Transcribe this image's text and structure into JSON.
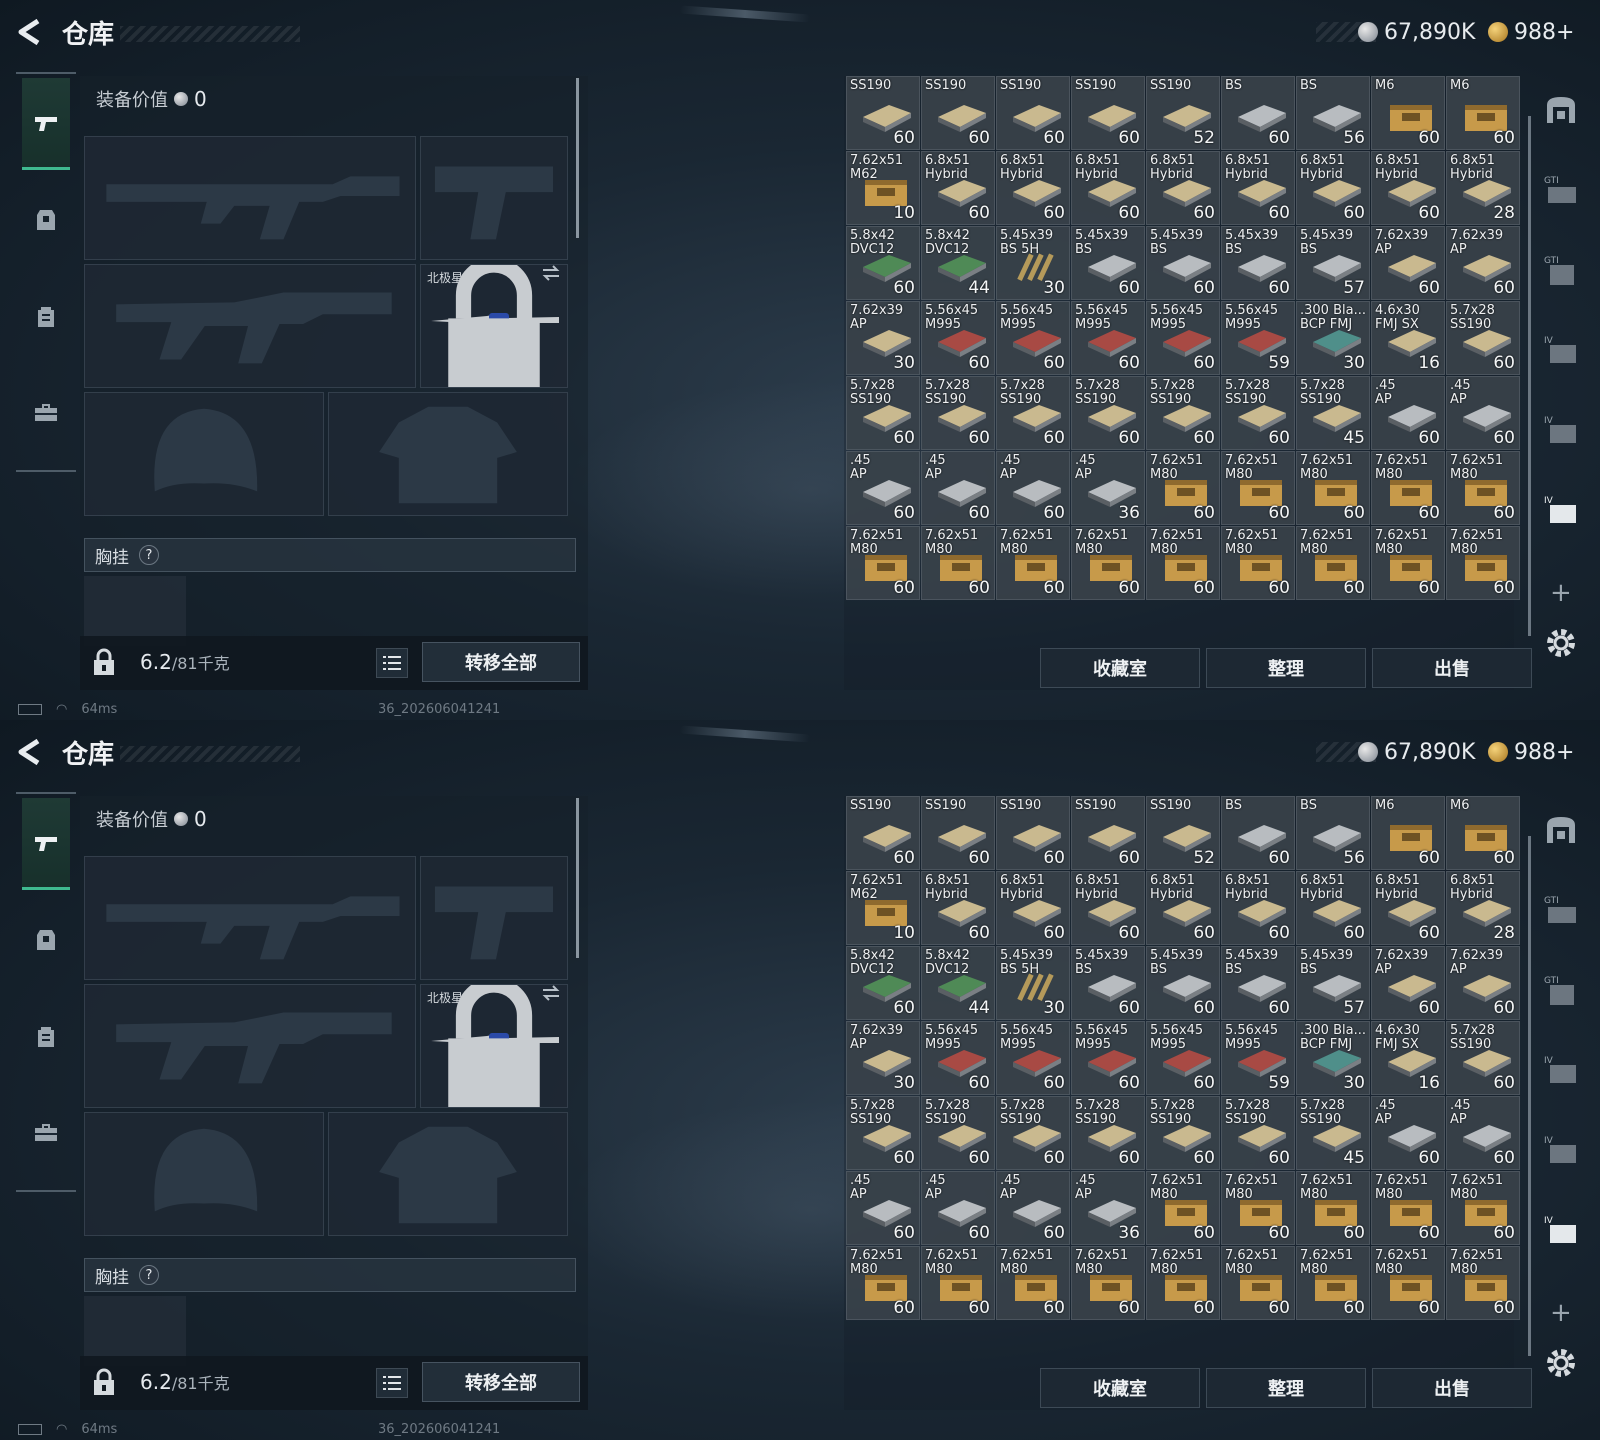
{
  "header": {
    "title": "仓库",
    "silver": "67,890K",
    "gold": "988+"
  },
  "equipment": {
    "value_label": "装备价值",
    "value": "0",
    "melee_name": "北极星",
    "chest_label": "胸挂",
    "help": "?",
    "weight": "6.2",
    "capacity": "/81千克",
    "transfer_all": "转移全部"
  },
  "status": {
    "ping": "64ms",
    "build": "36_202606041241"
  },
  "storage": {
    "actions": [
      "收藏室",
      "整理",
      "出售"
    ],
    "items": [
      {
        "name": "SS190",
        "count": "60",
        "type": "tan"
      },
      {
        "name": "SS190",
        "count": "60",
        "type": "tan"
      },
      {
        "name": "SS190",
        "count": "60",
        "type": "tan"
      },
      {
        "name": "SS190",
        "count": "60",
        "type": "tan"
      },
      {
        "name": "SS190",
        "count": "52",
        "type": "tan"
      },
      {
        "name": "BS",
        "count": "60",
        "type": "grey"
      },
      {
        "name": "BS",
        "count": "56",
        "type": "grey"
      },
      {
        "name": "M6",
        "count": "60",
        "type": "crate"
      },
      {
        "name": "M6",
        "count": "60",
        "type": "crate"
      },
      {
        "name": "7.62x51\nM62",
        "count": "10",
        "type": "crate"
      },
      {
        "name": "6.8x51\nHybrid",
        "count": "60",
        "type": "tan"
      },
      {
        "name": "6.8x51\nHybrid",
        "count": "60",
        "type": "tan"
      },
      {
        "name": "6.8x51\nHybrid",
        "count": "60",
        "type": "tan"
      },
      {
        "name": "6.8x51\nHybrid",
        "count": "60",
        "type": "tan"
      },
      {
        "name": "6.8x51\nHybrid",
        "count": "60",
        "type": "tan"
      },
      {
        "name": "6.8x51\nHybrid",
        "count": "60",
        "type": "tan"
      },
      {
        "name": "6.8x51\nHybrid",
        "count": "60",
        "type": "tan"
      },
      {
        "name": "6.8x51\nHybrid",
        "count": "28",
        "type": "tan"
      },
      {
        "name": "5.8x42\nDVC12",
        "count": "60",
        "type": "green"
      },
      {
        "name": "5.8x42\nDVC12",
        "count": "44",
        "type": "green"
      },
      {
        "name": "5.45x39\nBS 5H",
        "count": "30",
        "type": "rounds"
      },
      {
        "name": "5.45x39\nBS",
        "count": "60",
        "type": "grey"
      },
      {
        "name": "5.45x39\nBS",
        "count": "60",
        "type": "grey"
      },
      {
        "name": "5.45x39\nBS",
        "count": "60",
        "type": "grey"
      },
      {
        "name": "5.45x39\nBS",
        "count": "57",
        "type": "grey"
      },
      {
        "name": "7.62x39\nAP",
        "count": "60",
        "type": "tan"
      },
      {
        "name": "7.62x39\nAP",
        "count": "60",
        "type": "tan"
      },
      {
        "name": "7.62x39\nAP",
        "count": "30",
        "type": "tan"
      },
      {
        "name": "5.56x45\nM995",
        "count": "60",
        "type": "red"
      },
      {
        "name": "5.56x45\nM995",
        "count": "60",
        "type": "red"
      },
      {
        "name": "5.56x45\nM995",
        "count": "60",
        "type": "red"
      },
      {
        "name": "5.56x45\nM995",
        "count": "60",
        "type": "red"
      },
      {
        "name": "5.56x45\nM995",
        "count": "59",
        "type": "red"
      },
      {
        "name": ".300 Bla...\nBCP FMJ",
        "count": "30",
        "type": "teal"
      },
      {
        "name": "4.6x30\nFMJ SX",
        "count": "16",
        "type": "tan"
      },
      {
        "name": "5.7x28\nSS190",
        "count": "60",
        "type": "tan"
      },
      {
        "name": "5.7x28\nSS190",
        "count": "60",
        "type": "tan"
      },
      {
        "name": "5.7x28\nSS190",
        "count": "60",
        "type": "tan"
      },
      {
        "name": "5.7x28\nSS190",
        "count": "60",
        "type": "tan"
      },
      {
        "name": "5.7x28\nSS190",
        "count": "60",
        "type": "tan"
      },
      {
        "name": "5.7x28\nSS190",
        "count": "60",
        "type": "tan"
      },
      {
        "name": "5.7x28\nSS190",
        "count": "60",
        "type": "tan"
      },
      {
        "name": "5.7x28\nSS190",
        "count": "45",
        "type": "tan"
      },
      {
        "name": ".45\nAP",
        "count": "60",
        "type": "grey"
      },
      {
        "name": ".45\nAP",
        "count": "60",
        "type": "grey"
      },
      {
        "name": ".45\nAP",
        "count": "60",
        "type": "grey"
      },
      {
        "name": ".45\nAP",
        "count": "60",
        "type": "grey"
      },
      {
        "name": ".45\nAP",
        "count": "60",
        "type": "grey"
      },
      {
        "name": ".45\nAP",
        "count": "36",
        "type": "grey"
      },
      {
        "name": "7.62x51\nM80",
        "count": "60",
        "type": "crate"
      },
      {
        "name": "7.62x51\nM80",
        "count": "60",
        "type": "crate"
      },
      {
        "name": "7.62x51\nM80",
        "count": "60",
        "type": "crate"
      },
      {
        "name": "7.62x51\nM80",
        "count": "60",
        "type": "crate"
      },
      {
        "name": "7.62x51\nM80",
        "count": "60",
        "type": "crate"
      },
      {
        "name": "7.62x51\nM80",
        "count": "60",
        "type": "crate"
      },
      {
        "name": "7.62x51\nM80",
        "count": "60",
        "type": "crate"
      },
      {
        "name": "7.62x51\nM80",
        "count": "60",
        "type": "crate"
      },
      {
        "name": "7.62x51\nM80",
        "count": "60",
        "type": "crate"
      },
      {
        "name": "7.62x51\nM80",
        "count": "60",
        "type": "crate"
      },
      {
        "name": "7.62x51\nM80",
        "count": "60",
        "type": "crate"
      },
      {
        "name": "7.62x51\nM80",
        "count": "60",
        "type": "crate"
      },
      {
        "name": "7.62x51\nM80",
        "count": "60",
        "type": "crate"
      },
      {
        "name": "7.62x51\nM80",
        "count": "60",
        "type": "crate"
      }
    ]
  },
  "icon_colors": {
    "tan": "#c9b98f",
    "grey": "#b8bcc0",
    "green": "#4f8a56",
    "red": "#a84a44",
    "teal": "#4f8f8a",
    "crate": "#c79a4a",
    "accent": "#3fb98f"
  }
}
